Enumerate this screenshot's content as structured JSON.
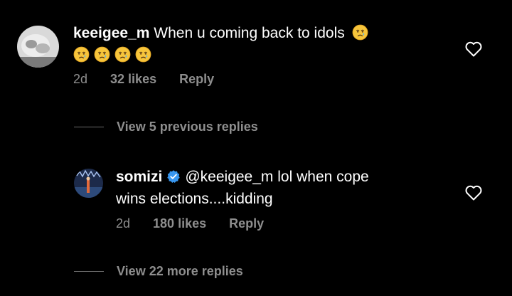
{
  "comment": {
    "username": "keeigee_m",
    "text": "When u coming back to idols",
    "time": "2d",
    "likes": "32 likes",
    "reply": "Reply"
  },
  "view_previous": "View 5 previous replies",
  "reply_comment": {
    "username": "somizi",
    "mention": "@keeigee_m",
    "text_line1": "lol when cope",
    "text_line2": "wins elections....kidding",
    "time": "2d",
    "likes": "180 likes",
    "reply": "Reply"
  },
  "view_more": "View 22 more replies",
  "colors": {
    "background": "#000000",
    "meta_gray": "#8e8e8e",
    "verified_blue": "#3897f0"
  }
}
